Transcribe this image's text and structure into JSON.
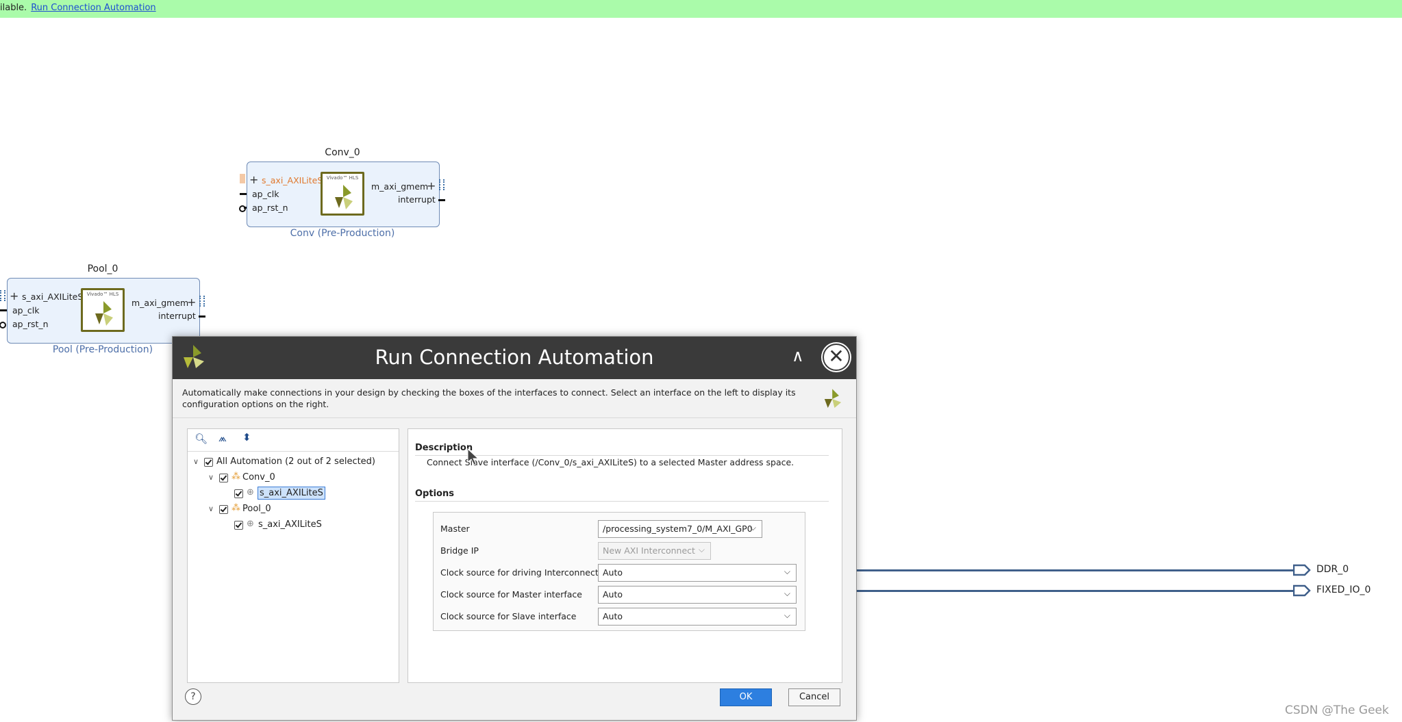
{
  "banner": {
    "text": "ilable.",
    "link": "Run Connection Automation"
  },
  "conv": {
    "name": "Conv_0",
    "subtitle": "Conv (Pre-Production)",
    "ports_left": [
      "s_axi_AXILiteS",
      "ap_clk",
      "ap_rst_n"
    ],
    "ports_right": [
      "m_axi_gmem",
      "interrupt"
    ],
    "logo_caption": "Vivado™ HLS"
  },
  "pool": {
    "name": "Pool_0",
    "subtitle": "Pool (Pre-Production)",
    "ports_left": [
      "s_axi_AXILiteS",
      "ap_clk",
      "ap_rst_n"
    ],
    "ports_right": [
      "m_axi_gmem",
      "interrupt"
    ],
    "logo_caption": "Vivado™ HLS"
  },
  "external_ports": [
    "DDR_0",
    "FIXED_IO_0"
  ],
  "dialog": {
    "title": "Run Connection Automation",
    "description": "Automatically make connections in your design by checking the boxes of the interfaces to connect. Select an interface on the left to display its configuration options on the right.",
    "tree": {
      "root": "All Automation (2 out of 2 selected)",
      "groups": [
        {
          "label": "Conv_0",
          "child": "s_axi_AXILiteS",
          "selected": true
        },
        {
          "label": "Pool_0",
          "child": "s_axi_AXILiteS",
          "selected": false
        }
      ]
    },
    "description_heading": "Description",
    "description_text": "Connect Slave interface (/Conv_0/s_axi_AXILiteS) to a selected Master address space.",
    "options_heading": "Options",
    "options": [
      {
        "label": "Master",
        "value": "/processing_system7_0/M_AXI_GP0",
        "disabled": false
      },
      {
        "label": "Bridge IP",
        "value": "New AXI Interconnect",
        "disabled": true
      },
      {
        "label": "Clock source for driving Interconnect IP",
        "value": "Auto",
        "disabled": false
      },
      {
        "label": "Clock source for Master interface",
        "value": "Auto",
        "disabled": false
      },
      {
        "label": "Clock source for Slave interface",
        "value": "Auto",
        "disabled": false
      }
    ],
    "ok_label": "OK",
    "cancel_label": "Cancel",
    "help_label": "?"
  },
  "watermark": "CSDN @The Geek",
  "colors": {
    "banner": "#aafbaa",
    "title_bar": "#3a3a3a",
    "ok_button": "#2d7fe0",
    "wire": "#3f5f8a"
  }
}
